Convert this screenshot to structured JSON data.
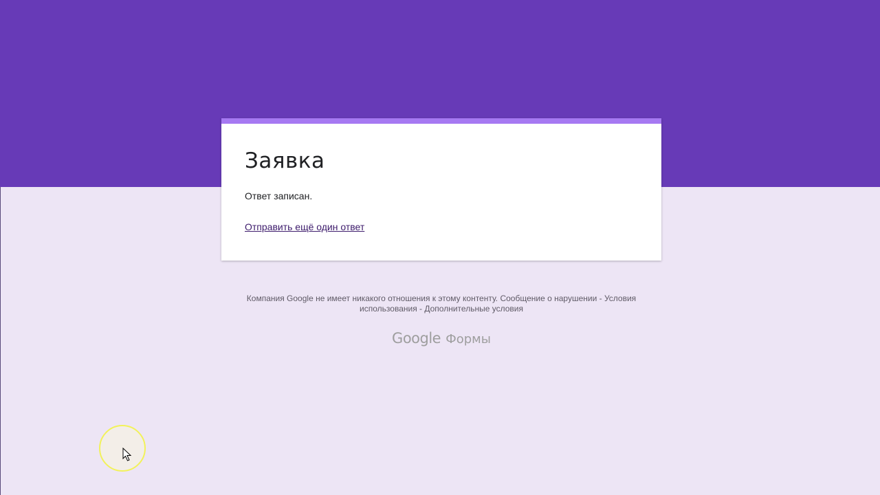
{
  "colors": {
    "banner": "#673ab7",
    "accent": "#a679f2",
    "background": "#ede5f5",
    "link": "#3c1a6b"
  },
  "card": {
    "title": "Заявка",
    "message": "Ответ записан.",
    "resubmit_link": "Отправить ещё один ответ"
  },
  "footer": {
    "disclaimer": "Компания Google не имеет никакого отношения к этому контенту.",
    "report_abuse": "Сообщение о нарушении",
    "terms": "Условия использования",
    "additional_terms": "Дополнительные условия",
    "separator": " - "
  },
  "brand": {
    "google": "Google",
    "forms": "Формы"
  },
  "cursor": {
    "icon": "mouse-pointer-icon"
  }
}
